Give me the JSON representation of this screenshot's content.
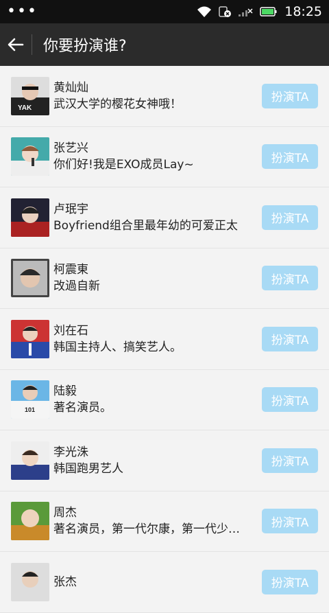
{
  "status": {
    "dots": "•••",
    "time": "18:25"
  },
  "header": {
    "title": "你要扮演谁?"
  },
  "button_label": "扮演TA",
  "people": [
    {
      "name": "黄灿灿",
      "desc": "武汉大学的樱花女神哦！"
    },
    {
      "name": "张艺兴",
      "desc": "你们好!我是EXO成员Lay~"
    },
    {
      "name": "卢珉宇",
      "desc": "Boyfriend组合里最年幼的可爱正太"
    },
    {
      "name": "柯震東",
      "desc": "改過自新"
    },
    {
      "name": "刘在石",
      "desc": "韩国主持人、搞笑艺人。"
    },
    {
      "name": "陆毅",
      "desc": "著名演员。"
    },
    {
      "name": "李光洙",
      "desc": "韩国跑男艺人"
    },
    {
      "name": "周杰",
      "desc": "著名演员，第一代尔康，第一代少…"
    },
    {
      "name": "张杰",
      "desc": ""
    }
  ]
}
